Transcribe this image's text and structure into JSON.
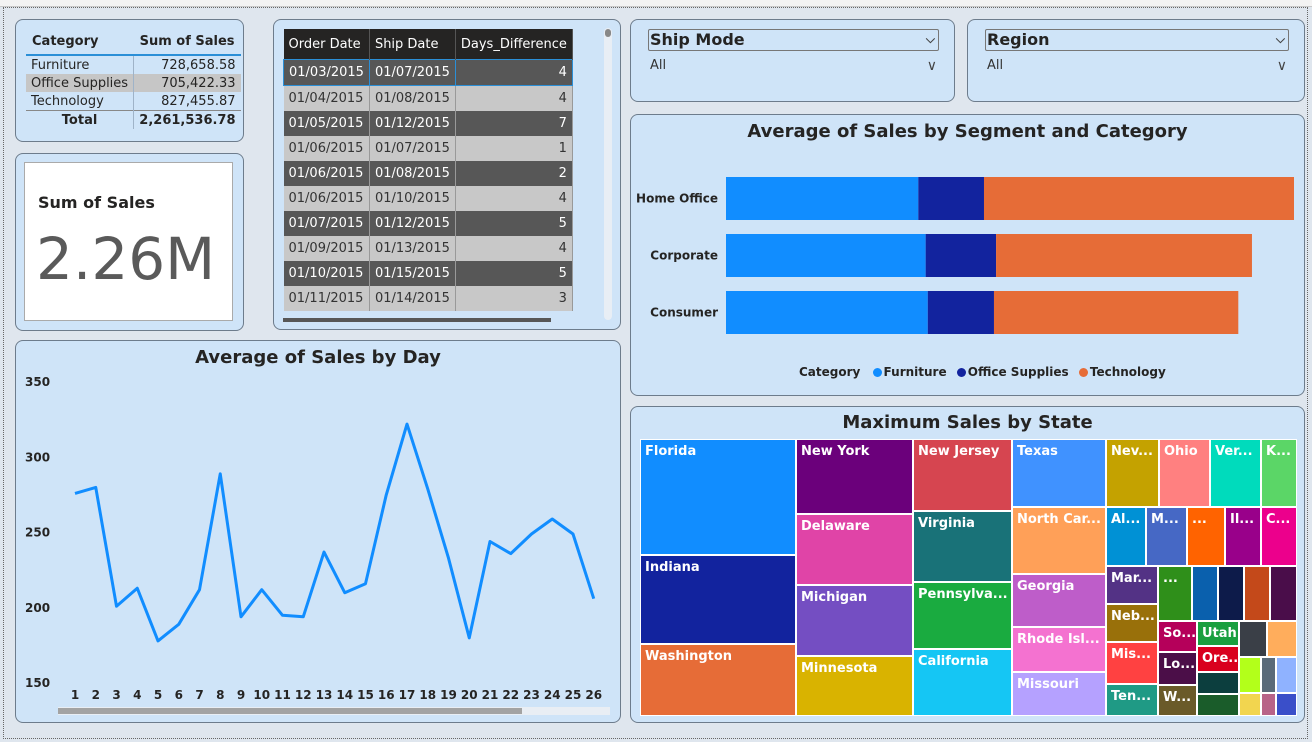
{
  "category_table": {
    "headers": [
      "Category",
      "Sum of Sales"
    ],
    "rows": [
      {
        "category": "Furniture",
        "sales": "728,658.58"
      },
      {
        "category": "Office Supplies",
        "sales": "705,422.33"
      },
      {
        "category": "Technology",
        "sales": "827,455.87"
      }
    ],
    "total_label": "Total",
    "total_value": "2,261,536.78"
  },
  "kpi": {
    "label": "Sum of Sales",
    "value": "2.26M"
  },
  "dates_table": {
    "headers": [
      "Order Date",
      "Ship Date",
      "Days_Difference"
    ],
    "rows": [
      {
        "order": "01/03/2015",
        "ship": "01/07/2015",
        "diff": "4"
      },
      {
        "order": "01/04/2015",
        "ship": "01/08/2015",
        "diff": "4"
      },
      {
        "order": "01/05/2015",
        "ship": "01/12/2015",
        "diff": "7"
      },
      {
        "order": "01/06/2015",
        "ship": "01/07/2015",
        "diff": "1"
      },
      {
        "order": "01/06/2015",
        "ship": "01/08/2015",
        "diff": "2"
      },
      {
        "order": "01/06/2015",
        "ship": "01/10/2015",
        "diff": "4"
      },
      {
        "order": "01/07/2015",
        "ship": "01/12/2015",
        "diff": "5"
      },
      {
        "order": "01/09/2015",
        "ship": "01/13/2015",
        "diff": "4"
      },
      {
        "order": "01/10/2015",
        "ship": "01/15/2015",
        "diff": "5"
      },
      {
        "order": "01/11/2015",
        "ship": "01/14/2015",
        "diff": "3"
      }
    ]
  },
  "slicers": {
    "ship_mode": {
      "title": "Ship Mode",
      "value": "All"
    },
    "region": {
      "title": "Region",
      "value": "All"
    }
  },
  "colors": {
    "furniture": "#118dff",
    "office_supplies": "#12239e",
    "technology": "#e66c37",
    "line": "#118dff"
  },
  "chart_data": [
    {
      "type": "bar",
      "title": "Average of Sales by Segment and Category",
      "stacked": true,
      "orientation": "horizontal",
      "categories": [
        "Home Office",
        "Corporate",
        "Consumer"
      ],
      "series": [
        {
          "name": "Furniture",
          "values": [
            366,
            380,
            384
          ]
        },
        {
          "name": "Office Supplies",
          "values": [
            125,
            134,
            126
          ]
        },
        {
          "name": "Technology",
          "values": [
            590,
            487,
            465
          ]
        }
      ],
      "legend_title": "Category",
      "legend_position": "bottom"
    },
    {
      "type": "line",
      "title": "Average of Sales by Day",
      "x": [
        1,
        2,
        3,
        4,
        5,
        6,
        7,
        8,
        9,
        10,
        11,
        12,
        13,
        14,
        15,
        16,
        17,
        18,
        19,
        20,
        21,
        22,
        23,
        24,
        25,
        26
      ],
      "y": [
        276,
        280,
        201,
        213,
        178,
        189,
        212,
        289,
        194,
        212,
        195,
        194,
        237,
        210,
        216,
        275,
        322,
        279,
        233,
        180,
        244,
        236,
        249,
        259,
        249,
        206
      ],
      "yticks": [
        150,
        200,
        250,
        300,
        350
      ],
      "ylim": [
        150,
        350
      ]
    },
    {
      "type": "treemap",
      "title": "Maximum Sales by State",
      "labels": [
        "Florida",
        "Indiana",
        "Washington",
        "New York",
        "Delaware",
        "Michigan",
        "Minnesota",
        "New Jersey",
        "Virginia",
        "Pennsylva...",
        "California",
        "Texas",
        "North Car...",
        "Georgia",
        "Rhode Isl...",
        "Missouri",
        "Nev...",
        "Ohio",
        "Ver...",
        "K...",
        "Al...",
        "M...",
        "...",
        "Il...",
        "C...",
        "Mar...",
        "...",
        "Neb...",
        "Mis...",
        "Ten...",
        "So...",
        "Utah",
        "Lo...",
        "Ore...",
        "W..."
      ]
    }
  ]
}
